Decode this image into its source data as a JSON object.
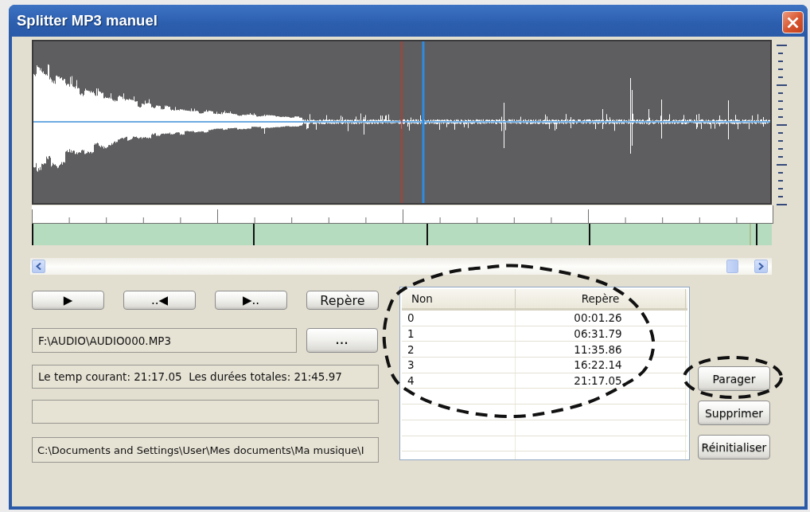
{
  "window": {
    "title": "Splitter MP3 manuel"
  },
  "transport_buttons": [
    {
      "label": "▶"
    },
    {
      "label": "..◀"
    },
    {
      "label": "▶.."
    },
    {
      "label": "Repère"
    }
  ],
  "file_field": {
    "value": "F:\\AUDIO\\AUDIO000.MP3"
  },
  "browse_button": {
    "label": "..."
  },
  "time_status": "Le temp courant: 21:17.05  Les durées totales: 21:45.97",
  "output_field": {
    "value": "C:\\Documents and Settings\\User\\Mes documents\\Ma musique\\I"
  },
  "table": {
    "columns": [
      "Non",
      "Repère"
    ],
    "rows": [
      [
        "0",
        "00:01.26"
      ],
      [
        "1",
        "06:31.79"
      ],
      [
        "2",
        "11:35.86"
      ],
      [
        "3",
        "16:22.14"
      ],
      [
        "4",
        "21:17.05"
      ]
    ]
  },
  "action_buttons": [
    {
      "label": "Parager"
    },
    {
      "label": "Supprimer"
    },
    {
      "label": "Réinitialiser"
    }
  ]
}
